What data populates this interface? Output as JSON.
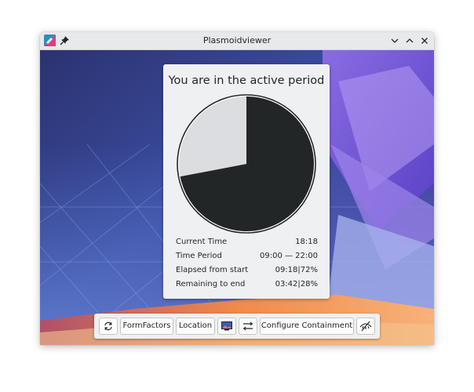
{
  "window": {
    "title": "Plasmoidviewer"
  },
  "card": {
    "title": "You are in the active period",
    "rows": [
      {
        "label": "Current Time",
        "value": "18:18"
      },
      {
        "label": "Time Period",
        "value": "09:00 — 22:00"
      },
      {
        "label": "Elapsed from start",
        "value": "09:18|72%"
      },
      {
        "label": "Remaining to end",
        "value": "03:42|28%"
      }
    ]
  },
  "chart_data": {
    "type": "pie",
    "title": "",
    "values": [
      72,
      28
    ],
    "colors": [
      "#232627",
      "#dcdde0"
    ]
  },
  "toolbar": {
    "refresh_icon": "refresh-icon",
    "formfactors_label": "FormFactors",
    "location_label": "Location",
    "wallpaper_icon": "wallpaper-icon",
    "settings_icon": "sliders-icon",
    "configure_label": "Configure Containment",
    "hide_icon": "hide-icon"
  },
  "colors": {
    "accent": "#3daee9",
    "pie_filled": "#232627",
    "pie_empty": "#dcdde0"
  }
}
